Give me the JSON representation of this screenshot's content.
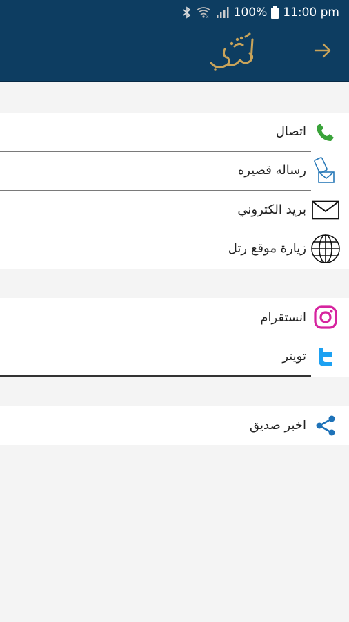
{
  "status_bar": {
    "battery_percent": "100%",
    "time": "11:00 pm",
    "icons": [
      "bluetooth-icon",
      "wifi-icon",
      "signal-icon",
      "battery-icon"
    ]
  },
  "app_bar": {
    "logo_name": "rattil-calligraphy-logo",
    "back_icon": "arrow-right-icon",
    "background": "#0d3d61",
    "logo_color": "#c9a45a"
  },
  "contact": {
    "items": [
      {
        "label": "اتصال",
        "icon": "phone-icon",
        "color": "#3aa33a"
      },
      {
        "label": "رساله قصيره",
        "icon": "sms-icon",
        "color": "#2a7ab8"
      },
      {
        "label": "بريد الكتروني",
        "icon": "mail-icon",
        "color": "#111111"
      },
      {
        "label": "زيارة موقع رتل",
        "icon": "globe-icon",
        "color": "#111111"
      }
    ]
  },
  "social": {
    "items": [
      {
        "label": "انستقرام",
        "icon": "instagram-icon",
        "color": "#d6249f"
      },
      {
        "label": "تويتر",
        "icon": "twitter-icon",
        "color": "#1da1f2"
      }
    ]
  },
  "share": {
    "items": [
      {
        "label": "اخبر صديق",
        "icon": "share-icon",
        "color": "#1e72b8"
      }
    ]
  }
}
